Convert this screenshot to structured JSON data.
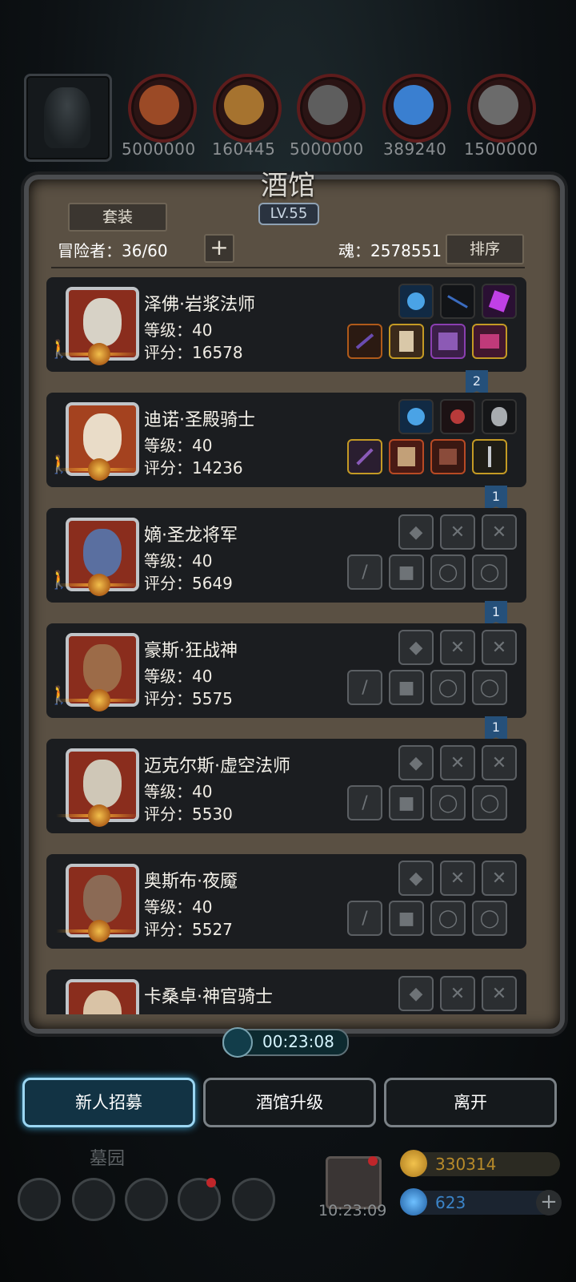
{
  "resources": [
    {
      "name": "meat",
      "value": "5000000",
      "color": "#9b4a26"
    },
    {
      "name": "wood",
      "value": "160445",
      "color": "#a6732f"
    },
    {
      "name": "stone",
      "value": "5000000",
      "color": "#5e5e5e"
    },
    {
      "name": "crystal",
      "value": "389240",
      "color": "#3a7fd0"
    },
    {
      "name": "iron",
      "value": "1500000",
      "color": "#6b6b6b"
    }
  ],
  "panel": {
    "title": "酒馆",
    "level": "LV.55",
    "suit_button": "套装",
    "adventurers_label": "冒险者：36/60",
    "add_button": "+",
    "soul_label": "魂：2578551",
    "sort_button": "排序"
  },
  "heroes": [
    {
      "name": "泽佛·岩浆法师",
      "level": "等级：40",
      "score": "评分：16578",
      "badge": "",
      "portrait_color": "#8a2d1d",
      "face_color": "#d7d2c6"
    },
    {
      "name": "迪诺·圣殿骑士",
      "level": "等级：40",
      "score": "评分：14236",
      "badge": "2",
      "portrait_color": "#a4421f",
      "face_color": "#e9dcc8"
    },
    {
      "name": "嫡·圣龙将军",
      "level": "等级：40",
      "score": "评分：5649",
      "badge": "1",
      "portrait_color": "#8a2d1d",
      "face_color": "#5a6fa0"
    },
    {
      "name": "豪斯·狂战神",
      "level": "等级：40",
      "score": "评分：5575",
      "badge": "1",
      "portrait_color": "#8a2d1d",
      "face_color": "#9c6b48"
    },
    {
      "name": "迈克尔斯·虚空法师",
      "level": "等级：40",
      "score": "评分：5530",
      "badge": "1",
      "portrait_color": "#8a2d1d",
      "face_color": "#cfc7b7"
    },
    {
      "name": "奥斯布·夜魇",
      "level": "等级：40",
      "score": "评分：5527",
      "badge": "",
      "portrait_color": "#8a2d1d",
      "face_color": "#8b6a55"
    },
    {
      "name": "卡桑卓·神官骑士",
      "level": "",
      "score": "",
      "badge": "",
      "portrait_color": "#8a2d1d",
      "face_color": "#d9c3a6"
    }
  ],
  "timer": "00:23:08",
  "buttons": {
    "recruit": "新人招募",
    "upgrade": "酒馆升级",
    "leave": "离开"
  },
  "bottom": {
    "graveyard": "墓园",
    "gift_time": "10:23:09",
    "gold": "330314",
    "gems": "623",
    "plus": "+"
  },
  "slot_icons": {
    "empty_top": [
      "◆",
      "✕",
      "✕"
    ],
    "empty_bottom": [
      "/",
      "■",
      "◯",
      "◯"
    ]
  }
}
